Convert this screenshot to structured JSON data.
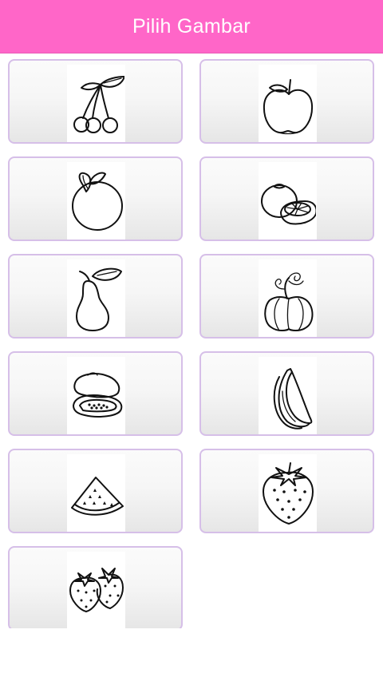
{
  "header": {
    "title": "Pilih Gambar"
  },
  "colors": {
    "appbar": "#ff66c8",
    "card_border": "#d6bfe8"
  },
  "items": [
    {
      "icon": "cherries-icon"
    },
    {
      "icon": "apple-icon"
    },
    {
      "icon": "orange-icon"
    },
    {
      "icon": "tangerine-icon"
    },
    {
      "icon": "pear-icon"
    },
    {
      "icon": "pumpkin-icon"
    },
    {
      "icon": "papaya-icon"
    },
    {
      "icon": "banana-icon"
    },
    {
      "icon": "watermelon-slice-icon"
    },
    {
      "icon": "strawberry-icon"
    },
    {
      "icon": "strawberries-icon"
    }
  ]
}
